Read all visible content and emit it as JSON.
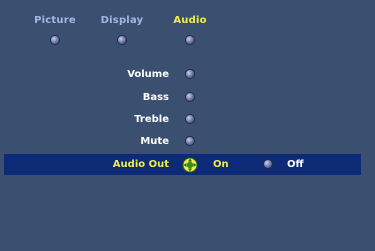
{
  "tabs": [
    {
      "label": "Picture",
      "active": false
    },
    {
      "label": "Display",
      "active": false
    },
    {
      "label": "Audio",
      "active": true
    }
  ],
  "menu": {
    "items": [
      {
        "label": "Volume"
      },
      {
        "label": "Bass"
      },
      {
        "label": "Treble"
      },
      {
        "label": "Mute"
      },
      {
        "label": "Audio Out"
      }
    ],
    "selected_item": "Audio Out",
    "audio_out_options": {
      "on_label": "On",
      "off_label": "Off",
      "current": "On"
    }
  },
  "colors": {
    "background": "#3b5070",
    "highlight": "#0c2a75",
    "active_text": "#f2ec4c",
    "inactive_tab_text": "#9fb8e6",
    "item_text": "#ffffff"
  }
}
